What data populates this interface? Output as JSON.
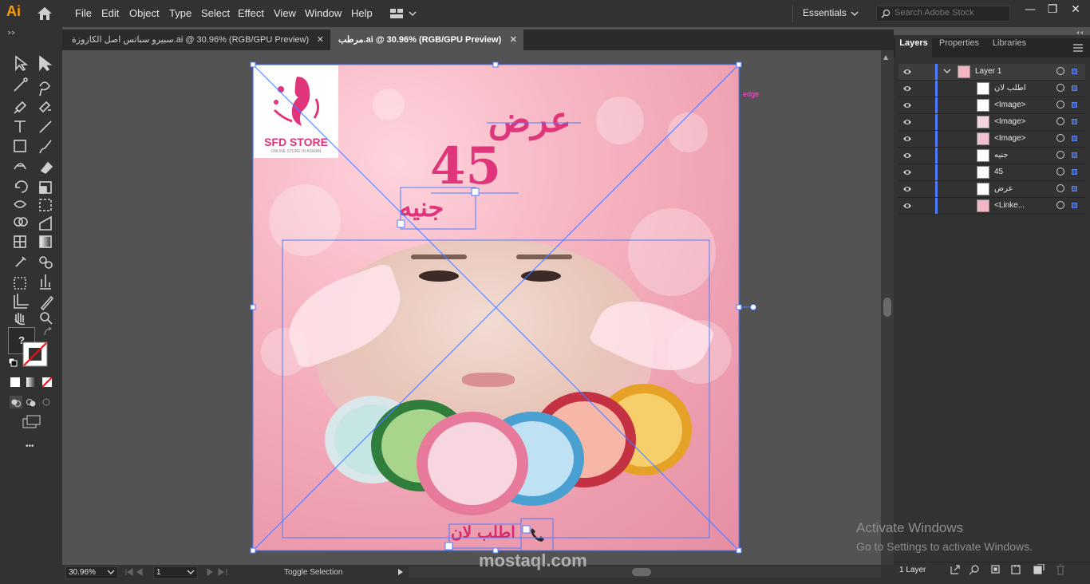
{
  "app": {
    "logo": "Ai",
    "workspace": "Essentials",
    "stock_placeholder": "Search Adobe Stock"
  },
  "menu": [
    "File",
    "Edit",
    "Object",
    "Type",
    "Select",
    "Effect",
    "View",
    "Window",
    "Help"
  ],
  "window_controls": {
    "minimize": "—",
    "maximize": "❐",
    "close": "✕"
  },
  "tabs": [
    {
      "label": "سبيرو سباتس اصل الكازوزة.ai @ 30.96% (RGB/GPU Preview)",
      "close": "✕",
      "active": false
    },
    {
      "label": "مرطب.ai @ 30.96% (RGB/GPU Preview)",
      "close": "✕",
      "active": true
    }
  ],
  "toolbar": {
    "question_mark": "?",
    "more": "•••"
  },
  "artboard": {
    "logo_text": "SFD STORE",
    "logo_subtext": "ONLINE STORE IN ASWAN",
    "offer": "عرض",
    "price": "45",
    "currency": "جنيه",
    "order_now": "اطلب لان",
    "edge_label": "edge"
  },
  "panel": {
    "tabs": [
      "Layers",
      "Properties",
      "Libraries"
    ],
    "layer_name": "Layer 1",
    "sublayers": [
      "اطلب لان",
      "<Image>",
      "<Image>",
      "<Image>",
      "جنيه",
      "45",
      "عرض",
      "<Linke..."
    ],
    "footer_count": "1 Layer"
  },
  "status": {
    "zoom": "30.96%",
    "artboard": "1",
    "tool": "Toggle Selection"
  },
  "overlay": {
    "activate_title": "Activate Windows",
    "activate_sub": "Go to Settings to activate Windows.",
    "watermark": "mostaql.com"
  },
  "colors": {
    "accent_pink": "#e0357b",
    "selection_blue": "#4f7cff",
    "ui_dark": "#323232"
  }
}
